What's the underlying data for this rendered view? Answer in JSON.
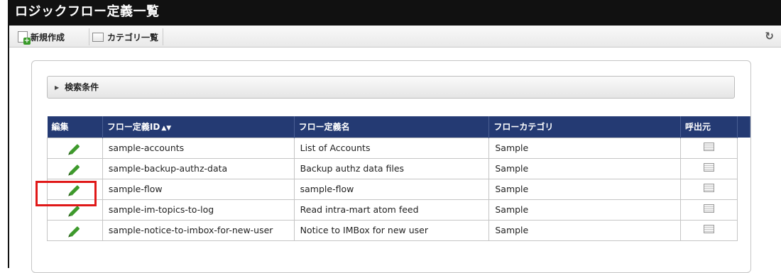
{
  "title": "ロジックフロー定義一覧",
  "toolbar": {
    "new_label": "新規作成",
    "category_list_label": "カテゴリ一覧",
    "refresh_icon": "refresh-icon"
  },
  "search": {
    "label": "検索条件"
  },
  "table": {
    "headers": {
      "edit": "編集",
      "flow_id": "フロー定義ID",
      "sort_glyph": "▲▼",
      "flow_name": "フロー定義名",
      "category": "フローカテゴリ",
      "caller": "呼出元"
    },
    "rows": [
      {
        "id": "sample-accounts",
        "name": "List of Accounts",
        "category": "Sample"
      },
      {
        "id": "sample-backup-authz-data",
        "name": "Backup authz data files",
        "category": "Sample"
      },
      {
        "id": "sample-flow",
        "name": "sample-flow",
        "category": "Sample"
      },
      {
        "id": "sample-im-topics-to-log",
        "name": "Read intra-mart atom feed",
        "category": "Sample"
      },
      {
        "id": "sample-notice-to-imbox-for-new-user",
        "name": "Notice to IMBox for new user",
        "category": "Sample"
      }
    ]
  },
  "colors": {
    "header_bg": "#243a73",
    "title_bg": "#111111",
    "highlight": "#e01818",
    "pencil": "#3e9a2c"
  }
}
